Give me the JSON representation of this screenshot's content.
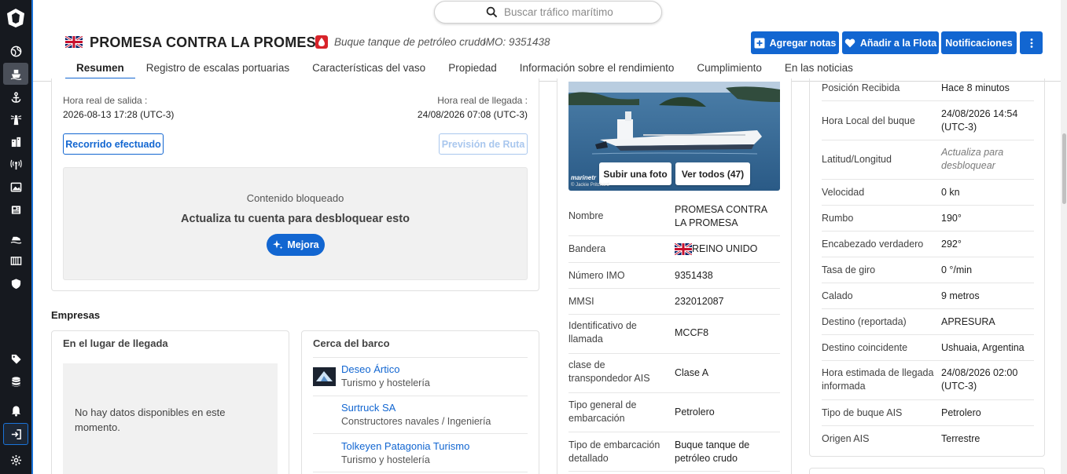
{
  "search": {
    "placeholder": "Buscar tráfico marítimo"
  },
  "vessel": {
    "name": "PROMESA CONTRA LA PROMESA",
    "type": "Buque tanque de petróleo crudo",
    "imo": "IMO: 9351438"
  },
  "actions": {
    "add_notes": "Agregar notas",
    "add_fleet": "Añadir a la Flota",
    "notifications": "Notificaciones"
  },
  "tabs": [
    {
      "label": "Resumen"
    },
    {
      "label": "Registro de escalas portuarias"
    },
    {
      "label": "Características del vaso"
    },
    {
      "label": "Propiedad"
    },
    {
      "label": "Información sobre el rendimiento"
    },
    {
      "label": "Cumplimiento"
    },
    {
      "label": "En las noticias"
    }
  ],
  "voyage": {
    "departure_label": "Hora real de salida :",
    "departure_value": "2026-08-13 17:28 (UTC-3)",
    "arrival_label": "Hora real de llegada :",
    "arrival_value": "24/08/2026 07:08 (UTC-3)",
    "route_button": "Recorrido efectuado",
    "forecast_button": "Previsión de Ruta"
  },
  "locked": {
    "title": "Contenido bloqueado",
    "subtitle": "Actualiza tu cuenta para desbloquear esto",
    "upgrade": "Mejora"
  },
  "companies": {
    "title": "Empresas",
    "arrival_title": "En el lugar de llegada",
    "no_data": "No hay datos disponibles en este momento.",
    "nearby_title": "Cerca del barco",
    "nearby": [
      {
        "name": "Deseo Ártico",
        "category": "Turismo y hostelería"
      },
      {
        "name": "Surtruck SA",
        "category": "Constructores navales / Ingeniería"
      },
      {
        "name": "Tolkeyen Patagonia Turismo",
        "category": "Turismo y hostelería"
      }
    ]
  },
  "photo": {
    "upload": "Subir una foto",
    "view_all": "Ver todos (47)",
    "credit": "marinetr",
    "author": "© Jackie Pritchard"
  },
  "details": [
    {
      "label": "Nombre",
      "value": "PROMESA CONTRA LA PROMESA"
    },
    {
      "label": "Bandera",
      "value": "REINO UNIDO"
    },
    {
      "label": "Número IMO",
      "value": "9351438"
    },
    {
      "label": "MMSI",
      "value": "232012087"
    },
    {
      "label": "Identificativo de llamada",
      "value": "MCCF8"
    },
    {
      "label": "clase de transpondedor AIS",
      "value": "Clase A"
    },
    {
      "label": "Tipo general de embarcación",
      "value": "Petrolero"
    },
    {
      "label": "Tipo de embarcación detallado",
      "value": "Buque tanque de petróleo crudo"
    }
  ],
  "position": [
    {
      "label": "Posición Recibida",
      "value": "Hace 8 minutos"
    },
    {
      "label": "Hora Local del buque",
      "value": "24/08/2026 14:54 (UTC-3)"
    },
    {
      "label": "Latitud/Longitud",
      "value": "Actualiza para desbloquear"
    },
    {
      "label": "Velocidad",
      "value": "0 kn"
    },
    {
      "label": "Rumbo",
      "value": "190°"
    },
    {
      "label": "Encabezado verdadero",
      "value": "292°"
    },
    {
      "label": "Tasa de giro",
      "value": "0 °/min"
    },
    {
      "label": "Calado",
      "value": "9 metros"
    },
    {
      "label": "Destino (reportada)",
      "value": "APRESURA"
    },
    {
      "label": "Destino coincidente",
      "value": "Ushuaia, Argentina"
    },
    {
      "label": "Hora estimada de llegada informada",
      "value": "24/08/2026 02:00 (UTC-3)"
    },
    {
      "label": "Tipo de buque AIS",
      "value": "Petrolero"
    },
    {
      "label": "Origen AIS",
      "value": "Terrestre"
    }
  ],
  "colors": {
    "primary": "#1266d1",
    "sidebar": "#16191f"
  }
}
